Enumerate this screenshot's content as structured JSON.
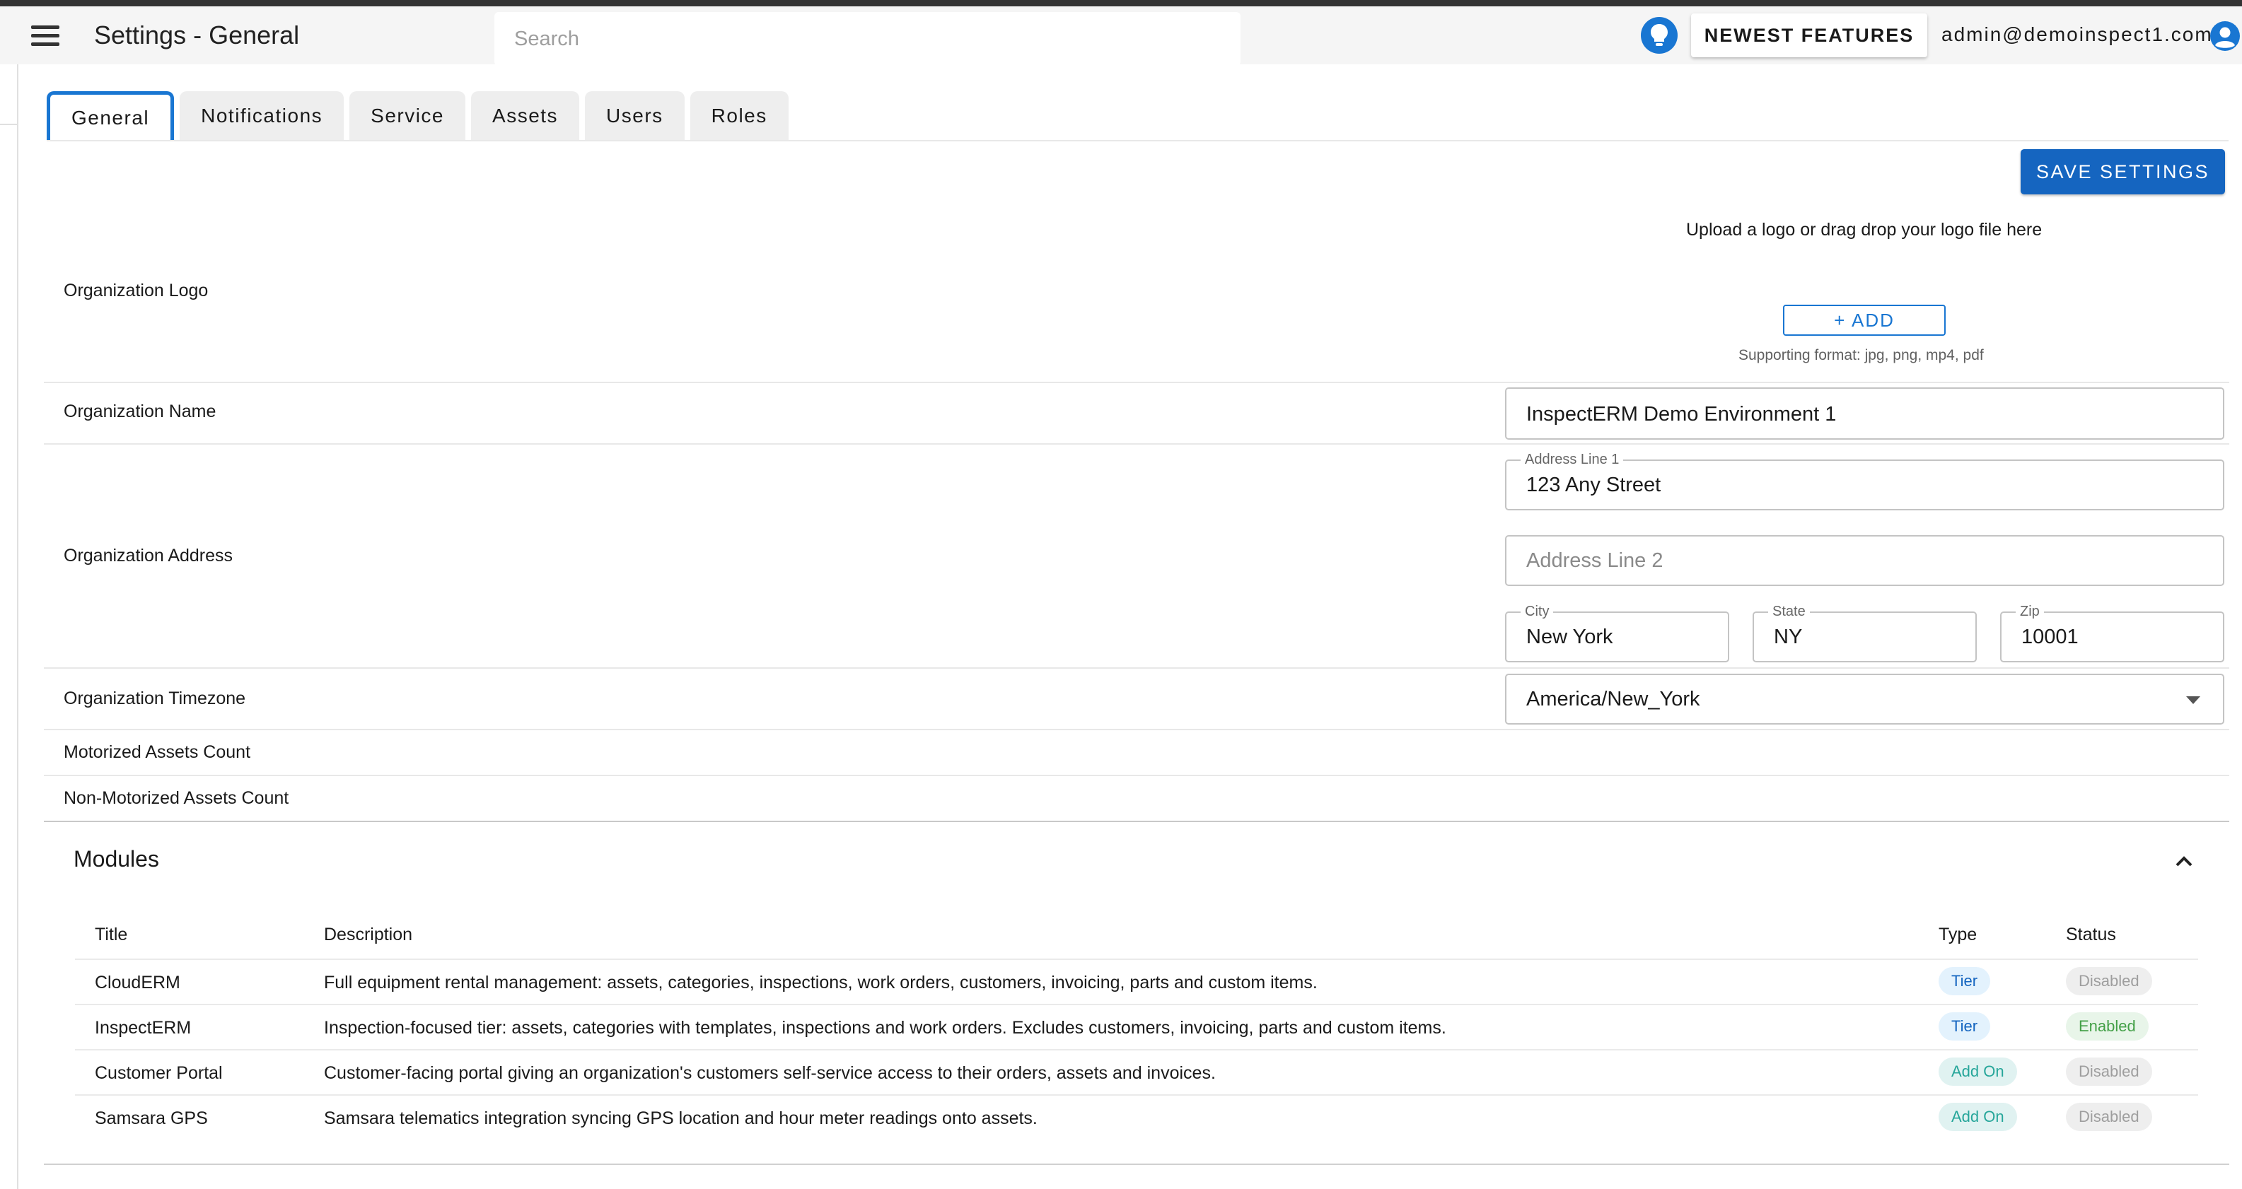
{
  "header": {
    "title": "Settings - General",
    "search_placeholder": "Search",
    "newest_features": "NEWEST FEATURES",
    "user_email": "admin@demoinspect1.com"
  },
  "tabs": [
    {
      "label": "General",
      "active": true
    },
    {
      "label": "Notifications",
      "active": false
    },
    {
      "label": "Service",
      "active": false
    },
    {
      "label": "Assets",
      "active": false
    },
    {
      "label": "Users",
      "active": false
    },
    {
      "label": "Roles",
      "active": false
    }
  ],
  "save_button": "SAVE SETTINGS",
  "logo": {
    "label": "Organization Logo",
    "upload_text": "Upload a logo or drag drop your logo file here",
    "add_button": "+ ADD",
    "formats": "Supporting format: jpg, png, mp4, pdf"
  },
  "org_name": {
    "label": "Organization Name",
    "value": "InspectERM Demo Environment 1"
  },
  "address": {
    "label": "Organization Address",
    "line1_label": "Address Line 1",
    "line1_value": "123 Any Street",
    "line2_placeholder": "Address Line 2",
    "city_label": "City",
    "city_value": "New York",
    "state_label": "State",
    "state_value": "NY",
    "zip_label": "Zip",
    "zip_value": "10001"
  },
  "timezone": {
    "label": "Organization Timezone",
    "value": "America/New_York"
  },
  "motorized_label": "Motorized Assets Count",
  "non_motorized_label": "Non-Motorized Assets Count",
  "modules": {
    "heading": "Modules",
    "columns": {
      "title": "Title",
      "description": "Description",
      "type": "Type",
      "status": "Status"
    },
    "rows": [
      {
        "title": "CloudERM",
        "description": "Full equipment rental management: assets, categories, inspections, work orders, customers, invoicing, parts and custom items.",
        "type": "Tier",
        "status": "Disabled"
      },
      {
        "title": "InspectERM",
        "description": "Inspection-focused tier: assets, categories with templates, inspections and work orders. Excludes customers, invoicing, parts and custom items.",
        "type": "Tier",
        "status": "Enabled"
      },
      {
        "title": "Customer Portal",
        "description": "Customer-facing portal giving an organization's customers self-service access to their orders, assets and invoices.",
        "type": "Add On",
        "status": "Disabled"
      },
      {
        "title": "Samsara GPS",
        "description": "Samsara telematics integration syncing GPS location and hour meter readings onto assets.",
        "type": "Add On",
        "status": "Disabled"
      }
    ]
  },
  "colors": {
    "primary": "#1976d2",
    "save_button": "#1565c0",
    "appbar_bg": "#f5f5f5",
    "enabled": "#43a047",
    "addon": "#26a69a"
  },
  "icons": {
    "menu": "hamburger-menu-icon",
    "bulb": "lightbulb-icon",
    "avatar": "account-circle-icon",
    "dropdown": "caret-down-icon",
    "collapse": "chevron-up-icon"
  }
}
